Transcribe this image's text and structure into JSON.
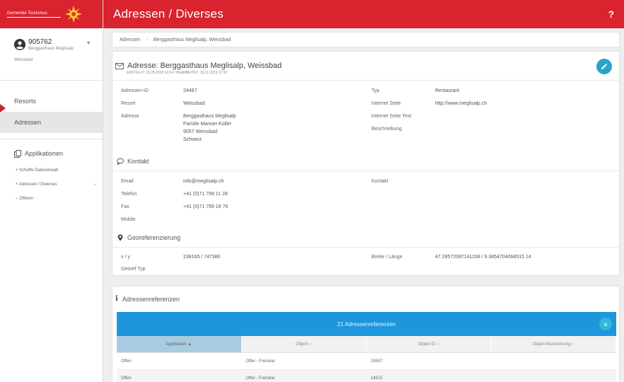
{
  "logo": {
    "text": "Gemeinde Tourismus"
  },
  "user": {
    "id": "905762",
    "subtitle": "Berggasthaus Meglisalp",
    "location": "Weissbad"
  },
  "nav": {
    "resorts": "Resorts",
    "adressen": "Adressen"
  },
  "applications": {
    "title": "Applikationen",
    "items": [
      {
        "label": "+ Scheffe Dateiverwalt"
      },
      {
        "label": "+ Adressen / Diverses"
      },
      {
        "label": "– Offeren"
      }
    ]
  },
  "header": {
    "title": "Adressen / Diverses",
    "help": "?"
  },
  "breadcrumb": {
    "items": [
      "Adressen",
      "Berggasthaus Meglisalp, Weissbad"
    ]
  },
  "address": {
    "title": "Adresse: Berggasthaus Meglisalp, Weissbad",
    "subtitle": "ERSTELLT: 15.05.2018 10:24 / BEARBEITET: 19.11.2019 17:32",
    "labels": {
      "adressen_id": "Adressen-ID",
      "resort": "Resort",
      "adresse": "Adresse",
      "typ": "Typ",
      "internet": "Internet Seite",
      "internet_text": "Internet Seite Text",
      "beschreibung": "Beschreibung"
    },
    "values": {
      "adressen_id": "24487",
      "resort": "Weissbad",
      "adresse_lines": [
        "Berggasthaus Meglisalp",
        "Familie Manser-Koller",
        "9057 Weissbad",
        "Schweiz"
      ],
      "typ": "Restaurant",
      "internet": "http://www.meglisalp.ch"
    }
  },
  "kontakt": {
    "title": "Kontakt",
    "labels": {
      "email": "Email",
      "telefon": "Telefon",
      "fax": "Fax",
      "mobile": "Mobile",
      "kontakt": "Kontakt"
    },
    "values": {
      "email": "info@meglisalp.ch",
      "telefon": "+41 (0)71 799 11 28",
      "fax": "+41 (0)71 799 19 76"
    }
  },
  "geo": {
    "title": "Georeferenzierung",
    "labels": {
      "xy": "x / y",
      "typ": "Georef Typ",
      "breite": "Breite / Länge"
    },
    "values": {
      "xy": "238165 / 747380",
      "breite": "47.28572087141158 / 9.3854704068515 14"
    }
  },
  "references": {
    "title": "Adressenreferenzen",
    "banner": "21 Adressenreferenzen",
    "fab": "a",
    "columns": [
      "Applikation ▲",
      "Objekt ○",
      "Objekt ID ○",
      "Objekt Bezeichnung ○"
    ],
    "rows": [
      [
        "Offen",
        "Offer - Fremdar",
        "24507",
        ""
      ],
      [
        "Offen",
        "Offer - Fremdar",
        "14515",
        ""
      ]
    ]
  },
  "colors": {
    "brand_red": "#d9232e",
    "accent_blue": "#1e96dc",
    "fab_teal": "#29a3c8"
  }
}
